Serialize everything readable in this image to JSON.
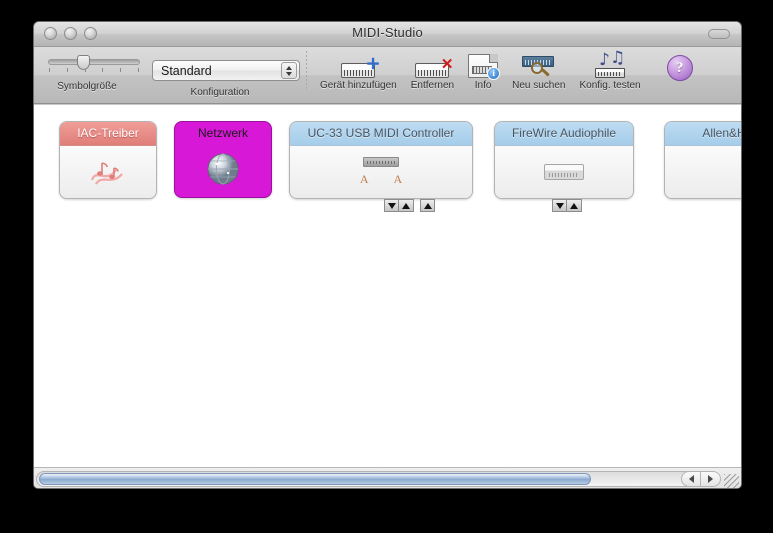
{
  "window": {
    "title": "MIDI-Studio",
    "traffic_lights": [
      "close",
      "minimize",
      "zoom"
    ]
  },
  "toolbar": {
    "icon_size": {
      "label": "Symbolgröße",
      "name": "icon-size-slider",
      "ticks": 6,
      "value_index": 2
    },
    "configuration": {
      "label": "Konfiguration",
      "selected": "Standard"
    },
    "buttons": [
      {
        "label": "Gerät hinzufügen",
        "icon": "keyboard-plus-icon",
        "name": "add-device-button"
      },
      {
        "label": "Entfernen",
        "icon": "keyboard-x-icon",
        "name": "remove-device-button"
      },
      {
        "label": "Info",
        "icon": "document-info-icon",
        "name": "info-button"
      },
      {
        "label": "Neu suchen",
        "icon": "rescan-icon",
        "name": "rescan-button"
      },
      {
        "label": "Konfig. testen",
        "icon": "test-setup-icon",
        "name": "test-setup-button"
      }
    ],
    "help": {
      "glyph": "?",
      "name": "help-button"
    }
  },
  "canvas": {
    "devices": [
      {
        "name": "IAC-Treiber",
        "style": "iac",
        "header_color": "#e88a84",
        "title_color": "#ffffff",
        "icon": "music-notes-icon",
        "selected": false,
        "ports": [],
        "arrow_groups": []
      },
      {
        "name": "Netzwerk",
        "style": "network",
        "header_color": "#d718d7",
        "title_color": "#1b1b1b",
        "icon": "globe-icon",
        "selected": true,
        "ports": [],
        "arrow_groups": []
      },
      {
        "name": "UC-33 USB MIDI Controller",
        "style": "blue",
        "header_color": "#a5cdea",
        "title_color": "#4b5560",
        "icon": "midi-interface-icon",
        "selected": false,
        "ports": [
          "A",
          "A"
        ],
        "arrow_groups": [
          [
            "down",
            "up"
          ],
          [
            "up"
          ]
        ]
      },
      {
        "name": "FireWire Audiophile",
        "style": "blue",
        "header_color": "#a5cdea",
        "title_color": "#4b5560",
        "icon": "firewire-interface-icon",
        "selected": false,
        "ports": [],
        "arrow_groups": [
          [
            "down",
            "up"
          ]
        ]
      },
      {
        "name": "Allen&H",
        "style": "blue",
        "header_color": "#a5cdea",
        "title_color": "#4b5560",
        "icon": "none",
        "selected": false,
        "clipped": true,
        "ports": [],
        "arrow_groups": []
      }
    ]
  },
  "scrollbar": {
    "orientation": "horizontal",
    "left_arrow": "◀",
    "right_arrow": "▶",
    "thumb_fraction": 0.88
  }
}
